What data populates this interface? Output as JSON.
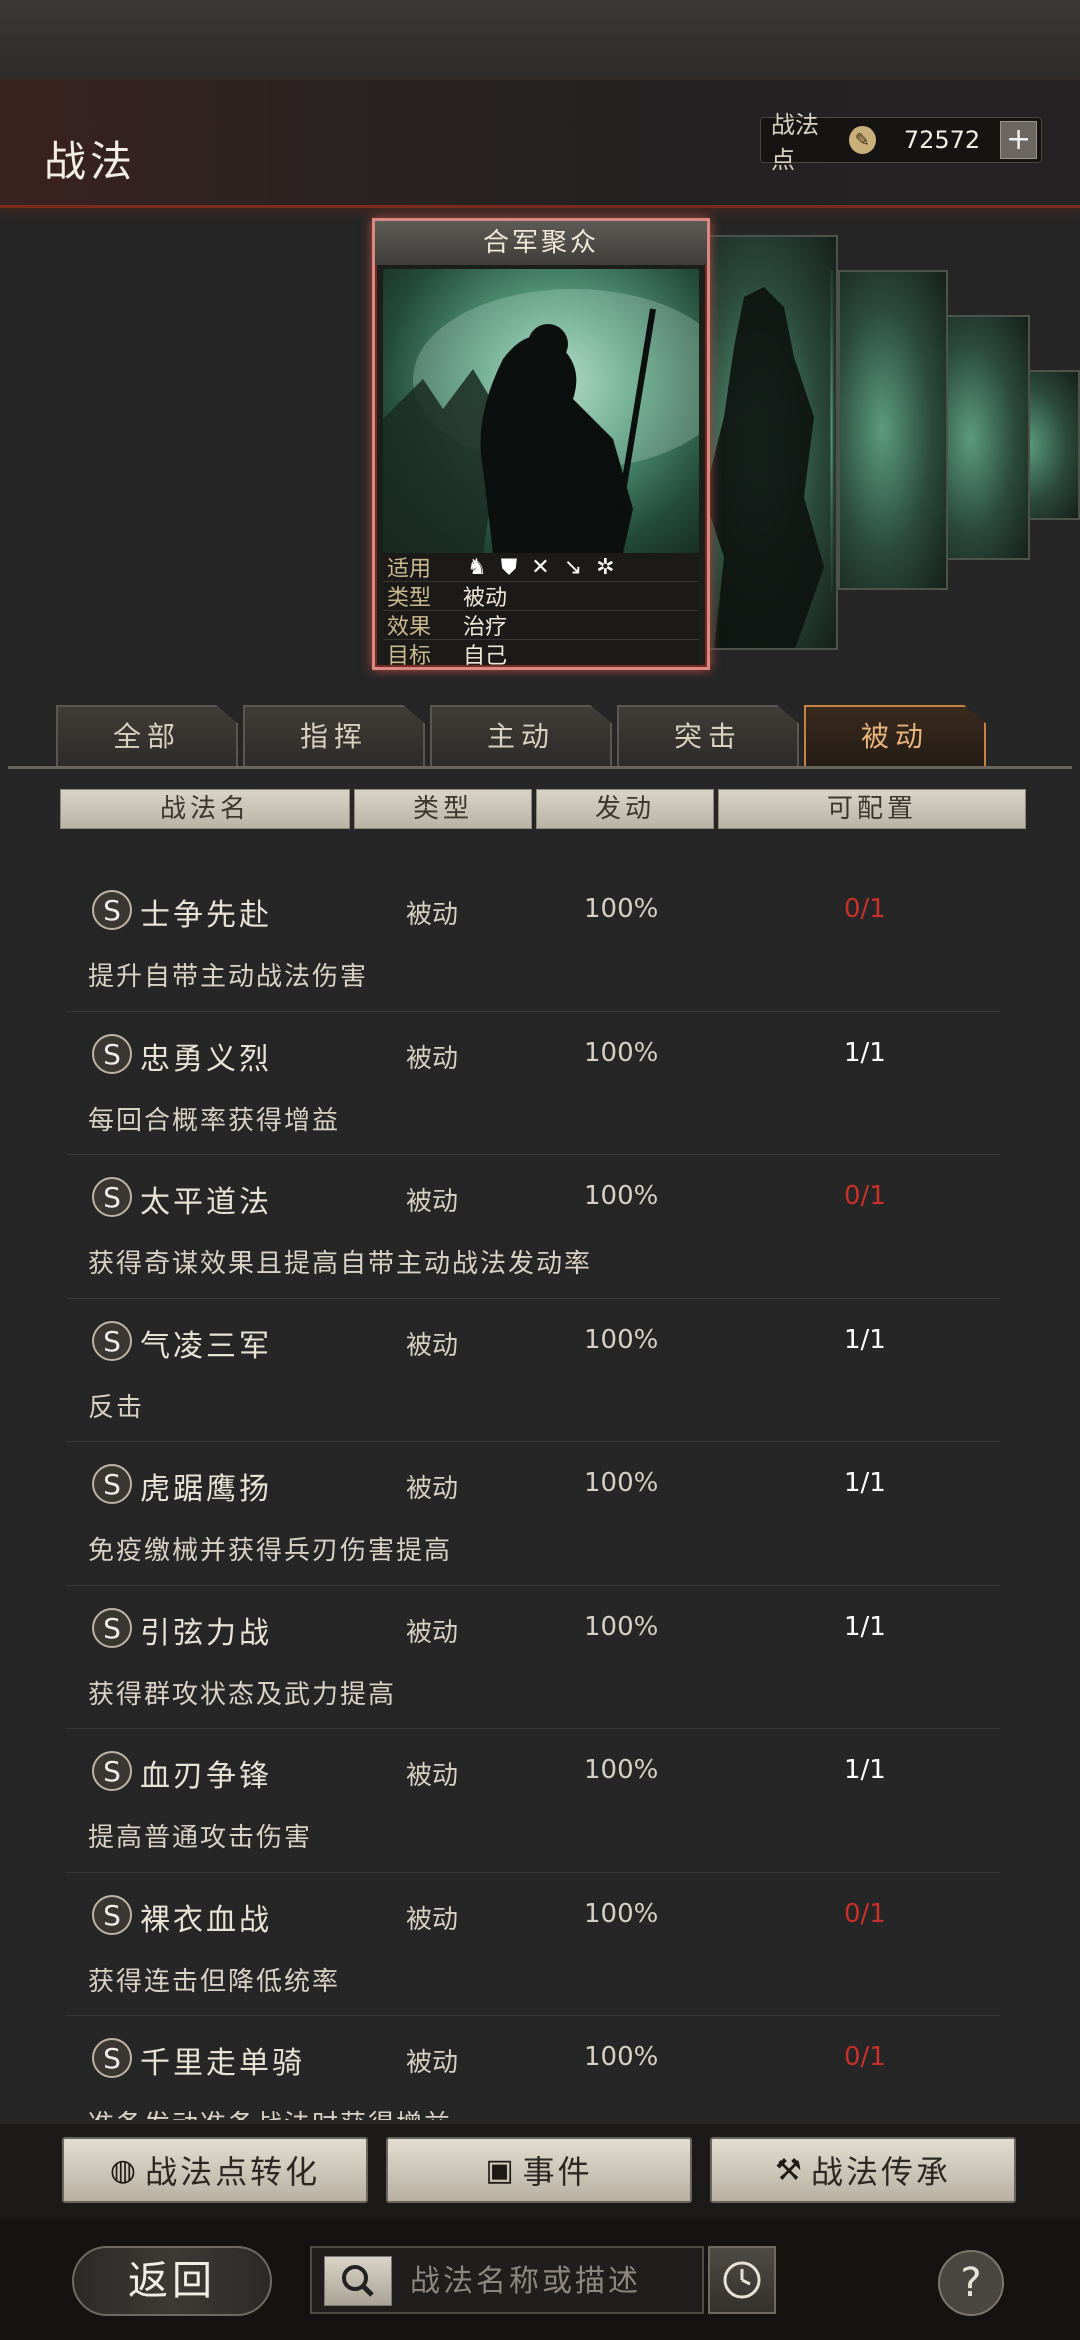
{
  "header": {
    "title": "战法",
    "points_label": "战法点",
    "points_value": "72572",
    "plus": "+"
  },
  "card": {
    "title": "合军聚众",
    "stats": [
      {
        "key": "适用",
        "value": ""
      },
      {
        "key": "类型",
        "value": "被动"
      },
      {
        "key": "效果",
        "value": "治疗"
      },
      {
        "key": "目标",
        "value": "自己"
      }
    ],
    "unit_icons": [
      "cavalry-icon",
      "shield-icon",
      "bow-icon",
      "spear-icon",
      "wheel-icon"
    ]
  },
  "tabs": [
    "全部",
    "指挥",
    "主动",
    "突击",
    "被动"
  ],
  "active_tab": "被动",
  "columns": [
    "战法名",
    "类型",
    "发动",
    "可配置"
  ],
  "skills": [
    {
      "grade": "S",
      "name": "士争先赴",
      "type": "被动",
      "rate": "100%",
      "config": "0/1",
      "available": false,
      "desc": "提升自带主动战法伤害"
    },
    {
      "grade": "S",
      "name": "忠勇义烈",
      "type": "被动",
      "rate": "100%",
      "config": "1/1",
      "available": true,
      "desc": "每回合概率获得增益"
    },
    {
      "grade": "S",
      "name": "太平道法",
      "type": "被动",
      "rate": "100%",
      "config": "0/1",
      "available": false,
      "desc": "获得奇谋效果且提高自带主动战法发动率"
    },
    {
      "grade": "S",
      "name": "气凌三军",
      "type": "被动",
      "rate": "100%",
      "config": "1/1",
      "available": true,
      "desc": "反击"
    },
    {
      "grade": "S",
      "name": "虎踞鹰扬",
      "type": "被动",
      "rate": "100%",
      "config": "1/1",
      "available": true,
      "desc": "免疫缴械并获得兵刃伤害提高"
    },
    {
      "grade": "S",
      "name": "引弦力战",
      "type": "被动",
      "rate": "100%",
      "config": "1/1",
      "available": true,
      "desc": "获得群攻状态及武力提高"
    },
    {
      "grade": "S",
      "name": "血刃争锋",
      "type": "被动",
      "rate": "100%",
      "config": "1/1",
      "available": true,
      "desc": "提高普通攻击伤害"
    },
    {
      "grade": "S",
      "name": "裸衣血战",
      "type": "被动",
      "rate": "100%",
      "config": "0/1",
      "available": false,
      "desc": "获得连击但降低统率"
    },
    {
      "grade": "S",
      "name": "千里走单骑",
      "type": "被动",
      "rate": "100%",
      "config": "0/1",
      "available": false,
      "desc": "准备发动准备战法时获得增益"
    }
  ],
  "buttons": {
    "convert": "战法点转化",
    "event": "事件",
    "inherit": "战法传承"
  },
  "footer": {
    "back": "返回",
    "search_placeholder": "战法名称或描述",
    "help": "?"
  },
  "colors": {
    "accent_red": "#c9302b",
    "active_tab": "#c6833d"
  }
}
